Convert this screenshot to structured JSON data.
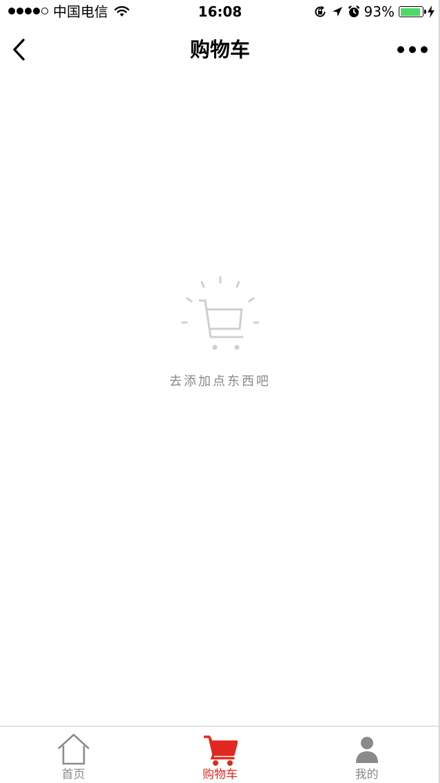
{
  "status_bar": {
    "carrier": "中国电信",
    "time": "16:08",
    "battery_percent": "93%",
    "battery_level": 0.93,
    "icons": [
      "signal-dots",
      "wifi-icon",
      "rotation-lock-icon",
      "location-arrow-icon",
      "alarm-icon",
      "battery-icon",
      "charging-bolt-icon"
    ]
  },
  "nav": {
    "title": "购物车",
    "back_icon": "chevron-left-icon",
    "more_icon": "more-dots-icon"
  },
  "empty_state": {
    "icon": "empty-cart-icon",
    "message": "去添加点东西吧"
  },
  "tab_bar": {
    "active_color": "#e0281e",
    "inactive_color": "#888888",
    "tabs": [
      {
        "label": "首页",
        "icon": "home-icon",
        "active": false
      },
      {
        "label": "购物车",
        "icon": "cart-icon",
        "active": true
      },
      {
        "label": "我的",
        "icon": "user-icon",
        "active": false
      }
    ]
  }
}
